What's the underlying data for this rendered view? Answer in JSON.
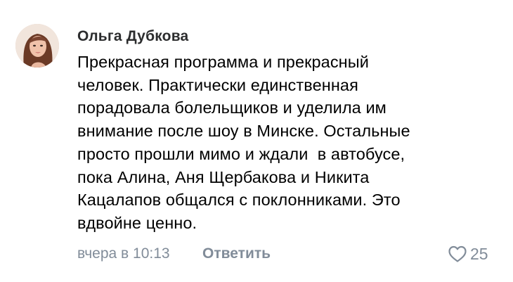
{
  "comment": {
    "author": "Ольга Дубкова",
    "text_lines": [
      "Прекрасная программа и прекрасный",
      "человек. Практически единственная",
      "порадовала болельщиков и уделила им",
      "внимание после шоу в Минске. Остальные",
      "просто прошли мимо и ждали  в автобусе,",
      "пока Алина, Аня Щербакова и Никита",
      "Кацалапов общался с поклонниками. Это",
      "вдвойне ценно."
    ],
    "date": "вчера в 10:13",
    "reply_label": "Ответить",
    "likes_count": "25",
    "like_icon": "heart-outline-icon",
    "colors": {
      "author": "#2c2d2e",
      "text": "#000000",
      "meta": "#818c99"
    }
  }
}
